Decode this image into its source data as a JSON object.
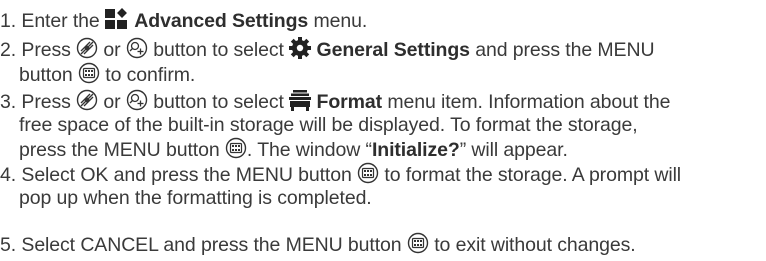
{
  "steps": [
    {
      "num": "1.",
      "t1": "Enter the",
      "icon": "advanced-settings-icon",
      "b1": "Advanced Settings",
      "t2": "menu."
    },
    {
      "num": "2.",
      "t1": "Press",
      "icon_a": "zoom-button-icon",
      "or": "or",
      "icon_b": "photo-button-icon",
      "t2": "button to select",
      "icon_c": "gear-icon",
      "b1": "General Settings",
      "t3": "and press the MENU",
      "t4": "button",
      "icon_d": "menu-button-icon",
      "t5": "to confirm."
    },
    {
      "num": "3.",
      "t1": "Press",
      "icon_a": "zoom-button-icon",
      "or": "or",
      "icon_b": "photo-button-icon",
      "t2": "button to select",
      "icon_c": "format-icon",
      "b1": "Format",
      "t3": "menu item. Information about the",
      "t4": "free space of the built-in storage will be displayed.  To format the storage,",
      "t5": "press the MENU button",
      "icon_d": "menu-button-icon",
      "t6": ".  The window “",
      "b2": "Initialize?",
      "t7": "” will appear."
    },
    {
      "num": "4.",
      "t1": "Select OK and press the MENU button",
      "icon_d": "menu-button-icon",
      "t2": "to format the storage. A prompt will",
      "t3": "pop up when the formatting is completed."
    },
    {
      "num": "5.",
      "t1": "Select CANCEL and press the MENU button",
      "icon_d": "menu-button-icon",
      "t2": "to exit without changes."
    }
  ]
}
